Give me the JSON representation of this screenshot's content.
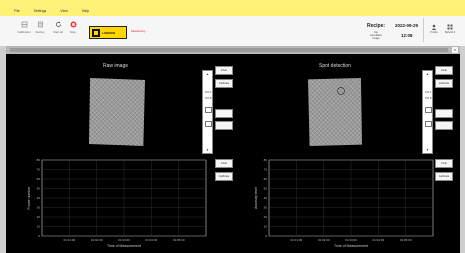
{
  "menu": {
    "items": [
      "File",
      "Settings",
      "View",
      "Help"
    ]
  },
  "toolbar": {
    "buttons": [
      {
        "label": "Calibration",
        "icon": "calibration-icon"
      },
      {
        "label": "Recipe",
        "icon": "recipe-icon"
      },
      {
        "label": "Start all",
        "icon": "refresh-icon"
      },
      {
        "label": "Stop",
        "icon": "stop-icon"
      }
    ],
    "logo_text": "LAVISION",
    "measuring_text": "Measuring..."
  },
  "header": {
    "recipe_label": "Recipe:",
    "recipe_sub": "big correlation image",
    "date": "2022-09-29",
    "time": "12:08"
  },
  "right_buttons": [
    {
      "label": "Profile",
      "icon": "user-icon"
    },
    {
      "label": "Behold-Il",
      "icon": "grid-icon"
    }
  ],
  "panels": {
    "raw_title": "Raw image",
    "spot_title": "Spot detection",
    "side_buttons": {
      "top": "Float",
      "mid": "Calibrate"
    },
    "scroll_labels": [
      "ROI A",
      "ROI B"
    ],
    "scroll_bottom_button": "Float",
    "scroll_bottom_sub": "Calibrate"
  },
  "charts_text": {
    "x_ticks": [
      "01:01:00",
      "01:02:00",
      "01:03:00",
      "01:04:00",
      "01:05:00"
    ],
    "y_ticks": [
      "0",
      "10",
      "20",
      "30",
      "40",
      "50",
      "60",
      "70",
      "80"
    ],
    "right_button": "Float",
    "right_sub": "Calibrate"
  },
  "chart_data": [
    {
      "type": "line",
      "title": "",
      "xlabel": "Time of Measurement",
      "ylabel": "Frame number",
      "x_ticks": [
        "01:01:00",
        "01:02:00",
        "01:03:00",
        "01:04:00",
        "01:05:00"
      ],
      "y_ticks": [
        0,
        10,
        20,
        30,
        40,
        50,
        60,
        70,
        80
      ],
      "ylim": [
        0,
        80
      ],
      "series": [],
      "grid": true
    },
    {
      "type": "line",
      "title": "",
      "xlabel": "Time of Measurement",
      "ylabel": "Anomaly level",
      "x_ticks": [
        "01:01:00",
        "01:02:00",
        "01:03:00",
        "01:04:00",
        "01:05:00"
      ],
      "y_ticks": [
        0,
        10,
        20,
        30,
        40,
        50,
        60,
        70,
        80
      ],
      "ylim": [
        0,
        80
      ],
      "series": [],
      "grid": true
    }
  ]
}
